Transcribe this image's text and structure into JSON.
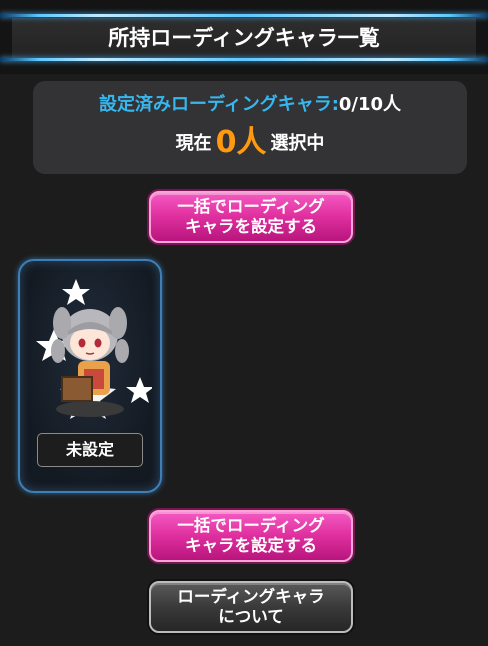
{
  "header": {
    "title": "所持ローディングキャラ一覧"
  },
  "summary": {
    "set_label": "設定済みローディングキャラ:",
    "set_count": "0/10人",
    "current_prefix": "現在",
    "current_count": "0人",
    "current_suffix": "選択中"
  },
  "buttons": {
    "bulk_set_top": "一括でローディング\nキャラを設定する",
    "bulk_set_bottom": "一括でローディング\nキャラを設定する",
    "about": "ローディングキャラ\nについて"
  },
  "characters": [
    {
      "status": "未設定",
      "icon": "chibi-character-icon"
    }
  ],
  "colors": {
    "accent_blue": "#37b7f0",
    "accent_orange": "#ff9a10",
    "button_pink": "#e0309f"
  }
}
